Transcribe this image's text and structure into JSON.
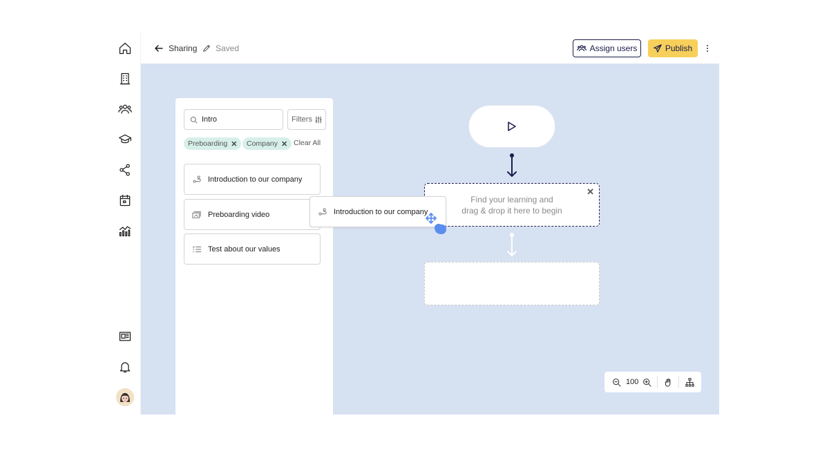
{
  "sidebar": {
    "items": [
      {
        "name": "home",
        "icon": "home-icon"
      },
      {
        "name": "company",
        "icon": "building-icon"
      },
      {
        "name": "users",
        "icon": "users-icon"
      },
      {
        "name": "learning",
        "icon": "graduation-cap-icon"
      },
      {
        "name": "sharing",
        "icon": "share-icon"
      },
      {
        "name": "calendar",
        "icon": "calendar-icon"
      },
      {
        "name": "analytics",
        "icon": "analytics-icon"
      }
    ],
    "bottom_items": [
      {
        "name": "news",
        "icon": "newspaper-icon"
      },
      {
        "name": "notifications",
        "icon": "bell-icon"
      },
      {
        "name": "profile",
        "icon": "avatar"
      }
    ]
  },
  "header": {
    "title": "Sharing",
    "status": "Saved",
    "assign_label": "Assign users",
    "publish_label": "Publish"
  },
  "library": {
    "search_value": "Intro",
    "filters_label": "Filters",
    "chips": [
      "Preboarding",
      "Company"
    ],
    "clear_label": "Clear All",
    "items": [
      {
        "label": "Introduction to our company",
        "icon": "path-icon"
      },
      {
        "label": "Preboarding video",
        "icon": "video-icon"
      },
      {
        "label": "Test about our values",
        "icon": "checklist-icon"
      }
    ]
  },
  "flow": {
    "dropzone_text_line1": "Find your learning and",
    "dropzone_text_line2": "drag & drop it here to begin",
    "dragged_item_label": "Introduction to our company"
  },
  "zoom": {
    "level": "100"
  },
  "colors": {
    "canvas": "#d6e1f2",
    "primary": "#1b1b4b",
    "publish": "#f7cf5b",
    "chip": "#d7efe9",
    "drag_cursor": "#5b8def"
  }
}
